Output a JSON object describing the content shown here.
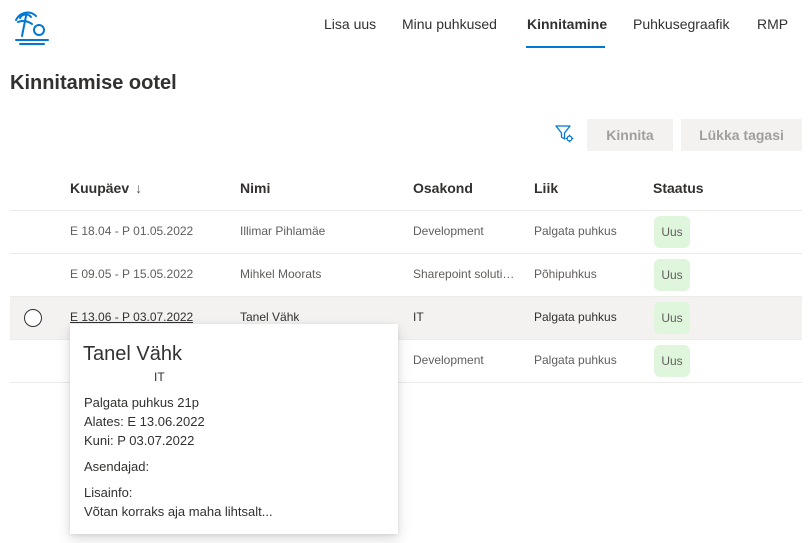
{
  "nav": {
    "items": [
      {
        "label": "Lisa uus"
      },
      {
        "label": "Minu puhkused"
      },
      {
        "label": "Kinnitamine"
      },
      {
        "label": "Puhkusegraafik"
      },
      {
        "label": "RMP"
      }
    ],
    "active": "Kinnitamine"
  },
  "page": {
    "title": "Kinnitamise ootel"
  },
  "toolbar": {
    "approve_label": "Kinnita",
    "reject_label": "Lükka tagasi",
    "filter_icon": "filter-settings-icon"
  },
  "table": {
    "columns": {
      "date": "Kuupäev",
      "sort_indicator": "↓",
      "name": "Nimi",
      "department": "Osakond",
      "type": "Liik",
      "status": "Staatus"
    },
    "rows": [
      {
        "date": "E 18.04 - P 01.05.2022",
        "name": "Illimar Pihlamäe",
        "department": "Development",
        "type": "Palgata puhkus",
        "status": "Uus"
      },
      {
        "date": "E 09.05 - P 15.05.2022",
        "name": "Mihkel Moorats",
        "department": "Sharepoint solutions",
        "type": "Põhipuhkus",
        "status": "Uus"
      },
      {
        "date": "E 13.06 - P 03.07.2022",
        "name": "Tanel Vähk",
        "department": "IT",
        "type": "Palgata puhkus",
        "status": "Uus"
      },
      {
        "date": "",
        "name": "",
        "department": "Development",
        "type": "Palgata puhkus",
        "status": "Uus"
      }
    ]
  },
  "popup": {
    "name": "Tanel Vähk",
    "department": "IT",
    "leave": "Palgata puhkus 21p",
    "from": "Alates: E 13.06.2022",
    "to": "Kuni: P 03.07.2022",
    "substitutes_label": "Asendajad:",
    "info_label": "Lisainfo:",
    "info_text": "Võtan korraks aja maha lihtsalt..."
  },
  "colors": {
    "accent": "#0078d4",
    "badge_bg": "#dff6dd",
    "row_hover": "#f3f2f1"
  }
}
